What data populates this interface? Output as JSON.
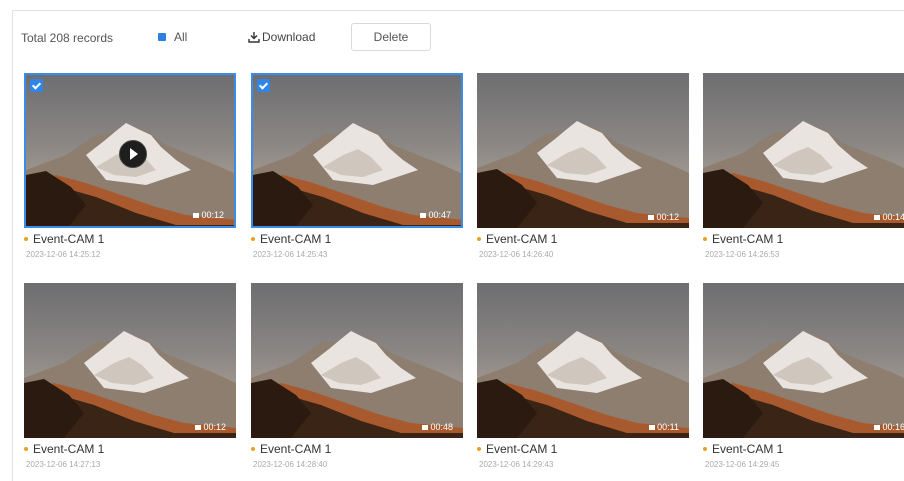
{
  "toolbar": {
    "total_text": "Total 208 records",
    "all_label": "All",
    "download_label": "Download",
    "delete_label": "Delete"
  },
  "records": [
    {
      "title": "Event-CAM 1",
      "timestamp": "2023-12-06 14:25:12",
      "badge": "00:12",
      "selected": true,
      "playing": true
    },
    {
      "title": "Event-CAM 1",
      "timestamp": "2023-12-06 14:25:43",
      "badge": "00:47",
      "selected": true,
      "playing": false
    },
    {
      "title": "Event-CAM 1",
      "timestamp": "2023-12-06 14:26:40",
      "badge": "00:12",
      "selected": false,
      "playing": false
    },
    {
      "title": "Event-CAM 1",
      "timestamp": "2023-12-06 14:26:53",
      "badge": "00:14",
      "selected": false,
      "playing": false
    },
    {
      "title": "Event-CAM 1",
      "timestamp": "2023-12-06 14:27:13",
      "badge": "00:12",
      "selected": false,
      "playing": false
    },
    {
      "title": "Event-CAM 1",
      "timestamp": "2023-12-06 14:28:40",
      "badge": "00:48",
      "selected": false,
      "playing": false
    },
    {
      "title": "Event-CAM 1",
      "timestamp": "2023-12-06 14:29:43",
      "badge": "00:11",
      "selected": false,
      "playing": false
    },
    {
      "title": "Event-CAM 1",
      "timestamp": "2023-12-06 14:29:45",
      "badge": "00:16",
      "selected": false,
      "playing": false
    }
  ],
  "colors": {
    "accent": "#2f86e8",
    "event_dot": "#f0a020"
  }
}
